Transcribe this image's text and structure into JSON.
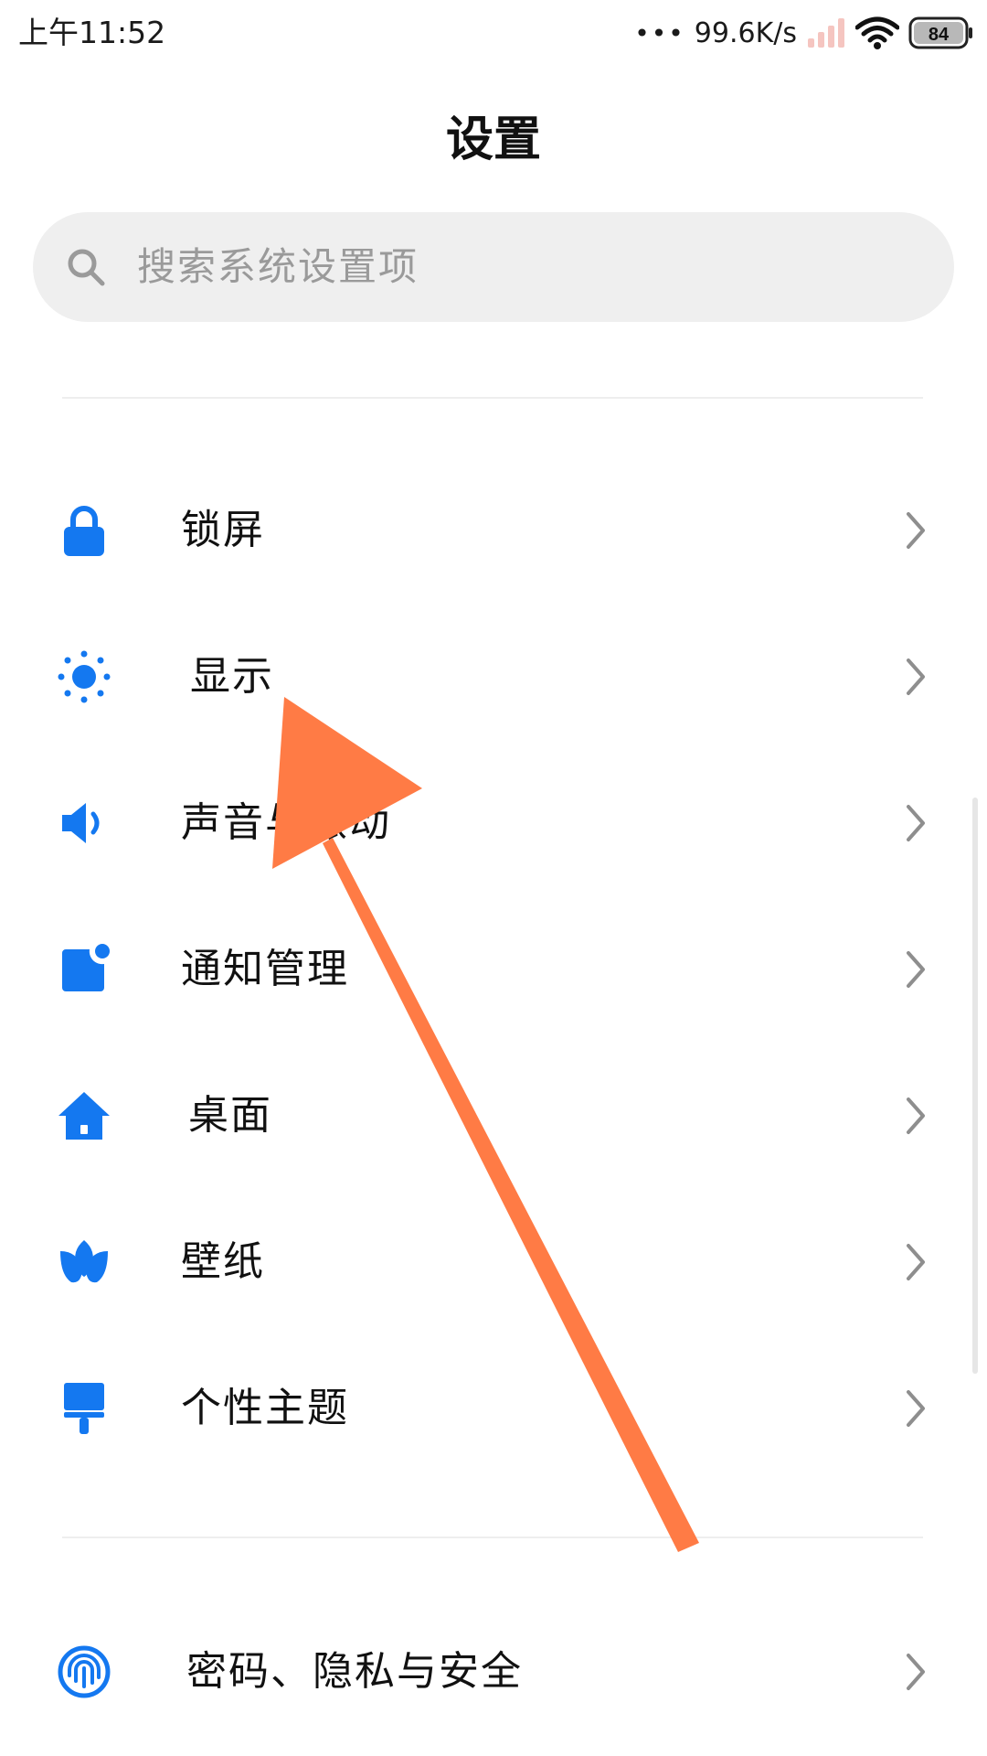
{
  "status_bar": {
    "time": "上午11:52",
    "dots": "•••",
    "net_speed": "99.6K/s",
    "battery": "84"
  },
  "header": {
    "title": "设置"
  },
  "search": {
    "placeholder": "搜索系统设置项"
  },
  "settings": {
    "items": [
      {
        "label": "锁屏",
        "icon": "lock-icon"
      },
      {
        "label": "显示",
        "icon": "sun-icon"
      },
      {
        "label": "声音与振动",
        "icon": "speaker-icon"
      },
      {
        "label": "通知管理",
        "icon": "notification-icon"
      },
      {
        "label": "桌面",
        "icon": "home-icon"
      },
      {
        "label": "壁纸",
        "icon": "tulip-icon"
      },
      {
        "label": "个性主题",
        "icon": "paint-brush-icon"
      },
      {
        "label": "密码、隐私与安全",
        "icon": "fingerprint-icon"
      }
    ]
  },
  "colors": {
    "accent": "#1478f0",
    "annotation_arrow": "#ff7b45",
    "search_bg": "#efefef",
    "placeholder": "#9a9a9a",
    "chevron": "#8e8e8e"
  }
}
